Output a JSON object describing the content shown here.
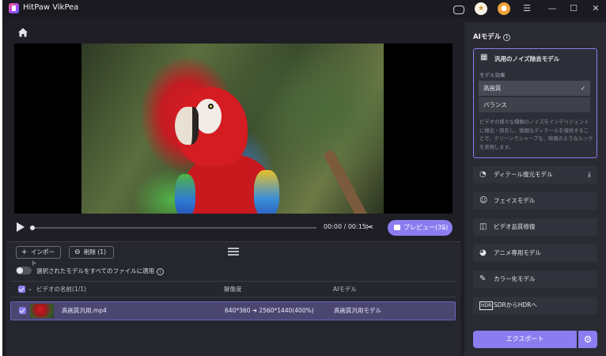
{
  "app": {
    "title": "HitPaw VikPea"
  },
  "titlebar_icons": [
    "discord-icon",
    "coin-icon",
    "account-icon",
    "menu-icon",
    "minimize-icon",
    "maximize-icon",
    "close-icon"
  ],
  "player": {
    "time": "00:00 / 00:15",
    "progress": 0.0,
    "preview_label": "プレビュー(3S)"
  },
  "list": {
    "import_label": "インポート",
    "delete_label": "削除 (1)",
    "apply_all_label": "選択されたモデルをすべてのファイルに適用",
    "header": {
      "name": "ビデオの名前(1/1)",
      "resolution": "解像度",
      "ai_model": "AIモデル"
    },
    "rows": [
      {
        "name": "高画質汎用.mp4",
        "resolution": "640*360 ➔ 2560*1440(400%)",
        "model": "高画質汎用モデル"
      }
    ]
  },
  "side": {
    "title": "AIモデル",
    "selected_model": {
      "label": "汎用のノイズ除去モデル",
      "effect_label": "モデル効果",
      "options": [
        "高画質",
        "バランス"
      ],
      "selected_option": "高画質",
      "description": "ビデオの様々な種類のノイズをインテリジェントに検出・除去し、微細なディテールを保持することで、クリーンでシャープな、映画のようなルックを実現します。"
    },
    "models": [
      "ディテール復元モデル",
      "フェイスモデル",
      "ビデオ品質修復",
      "アニメ専用モデル",
      "カラー化モデル",
      "SDRからHDRへ"
    ],
    "export_label": "エクスポート"
  },
  "colors": {
    "accent": "#8b7cf0",
    "panel": "#2a2a32",
    "background": "#1e1e24"
  }
}
